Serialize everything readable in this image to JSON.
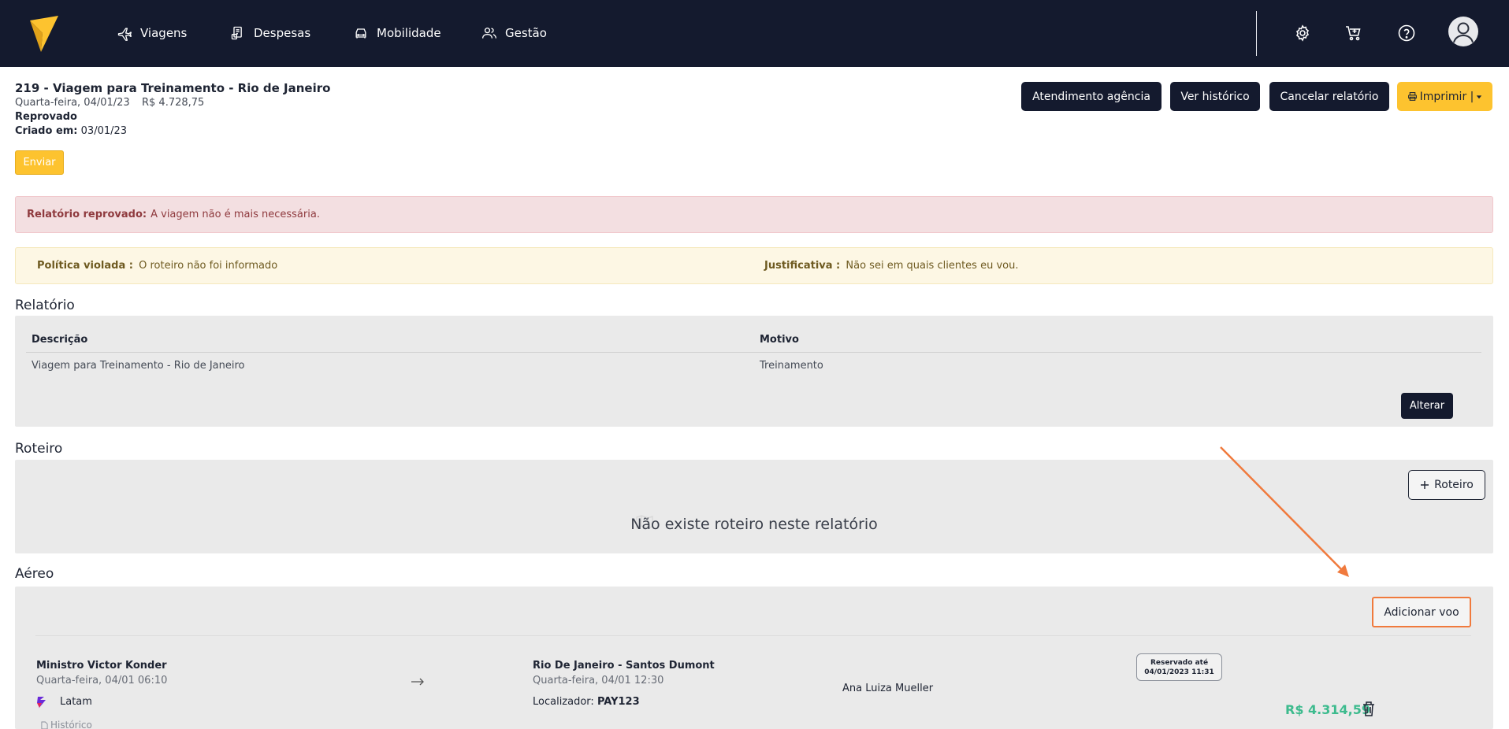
{
  "nav": {
    "items": [
      {
        "label": "Viagens",
        "icon": "airplane-icon"
      },
      {
        "label": "Despesas",
        "icon": "receipt-icon"
      },
      {
        "label": "Mobilidade",
        "icon": "car-icon"
      },
      {
        "label": "Gestão",
        "icon": "users-icon"
      }
    ]
  },
  "colors": {
    "topbar": "#141a2e",
    "accent_yellow": "#fdc32f",
    "price_green": "#3dbb8e",
    "annotation_orange": "#f07a3d",
    "alert_red_bg": "#f3dfe1",
    "alert_yellow_bg": "#fdf7e4"
  },
  "report": {
    "title": "219 - Viagem para Treinamento - Rio de Janeiro",
    "date": "Quarta-feira, 04/01/23",
    "total": "R$ 4.728,75",
    "status": "Reprovado",
    "created_label": "Criado em:",
    "created_value": "03/01/23",
    "send_label": "Enviar"
  },
  "actions": {
    "agency": "Atendimento agência",
    "history": "Ver histórico",
    "cancel": "Cancelar relatório",
    "print": "Imprimir |"
  },
  "alerts": {
    "rejected_label": "Relatório reprovado:",
    "rejected_text": "A viagem não é mais necessária.",
    "policy_label": "Política violada :",
    "policy_text": "O roteiro não foi informado",
    "justification_label": "Justificativa :",
    "justification_text": "Não sei em quais clientes eu vou."
  },
  "relatorio": {
    "section_title": "Relatório",
    "headers": [
      "Descrição",
      "Motivo"
    ],
    "row": [
      "Viagem para Treinamento - Rio de Janeiro",
      "Treinamento"
    ],
    "alter_label": "Alterar"
  },
  "roteiro": {
    "section_title": "Roteiro",
    "add_label": "Roteiro",
    "empty_message": "Não existe roteiro neste relatório"
  },
  "aereo": {
    "section_title": "Aéreo",
    "add_flight_label": "Adicionar voo",
    "flight": {
      "origin": "Ministro Victor Konder",
      "origin_time": "Quarta-feira, 04/01 06:10",
      "airline": "Latam",
      "destination": "Rio De Janeiro - Santos Dumont",
      "destination_time": "Quarta-feira, 04/01 12:30",
      "locator_label": "Localizador:",
      "locator": "PAY123",
      "passenger": "Ana Luiza Mueller",
      "reserved_label": "Reservado até",
      "reserved_until": "04/01/2023 11:31",
      "price": "R$ 4.314,59",
      "history_label": "Histórico"
    }
  }
}
